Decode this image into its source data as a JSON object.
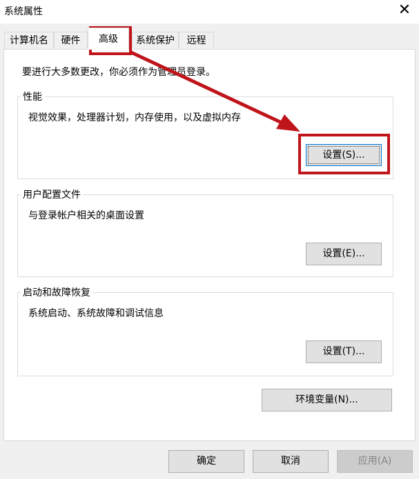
{
  "window": {
    "title": "系统属性",
    "close_glyph": "✕"
  },
  "tabs": [
    {
      "label": "计算机名"
    },
    {
      "label": "硬件"
    },
    {
      "label": "高级",
      "selected": true
    },
    {
      "label": "系统保护"
    },
    {
      "label": "远程"
    }
  ],
  "notice": "要进行大多数更改，你必须作为管理员登录。",
  "performance": {
    "title": "性能",
    "description": "视觉效果，处理器计划，内存使用，以及虚拟内存",
    "button": "设置(S)..."
  },
  "user_profiles": {
    "title": "用户配置文件",
    "description": "与登录帐户相关的桌面设置",
    "button": "设置(E)..."
  },
  "startup_recovery": {
    "title": "启动和故障恢复",
    "description": "系统启动、系统故障和调试信息",
    "button": "设置(T)..."
  },
  "env_button": "环境变量(N)...",
  "footer": {
    "ok": "确定",
    "cancel": "取消",
    "apply": "应用(A)",
    "apply_enabled": false
  },
  "annotation": {
    "color": "#c0141b",
    "highlights": [
      "tab-advanced",
      "performance-settings-button"
    ]
  },
  "icons": {
    "close": "close-icon",
    "arrow": "annotation-arrow"
  }
}
